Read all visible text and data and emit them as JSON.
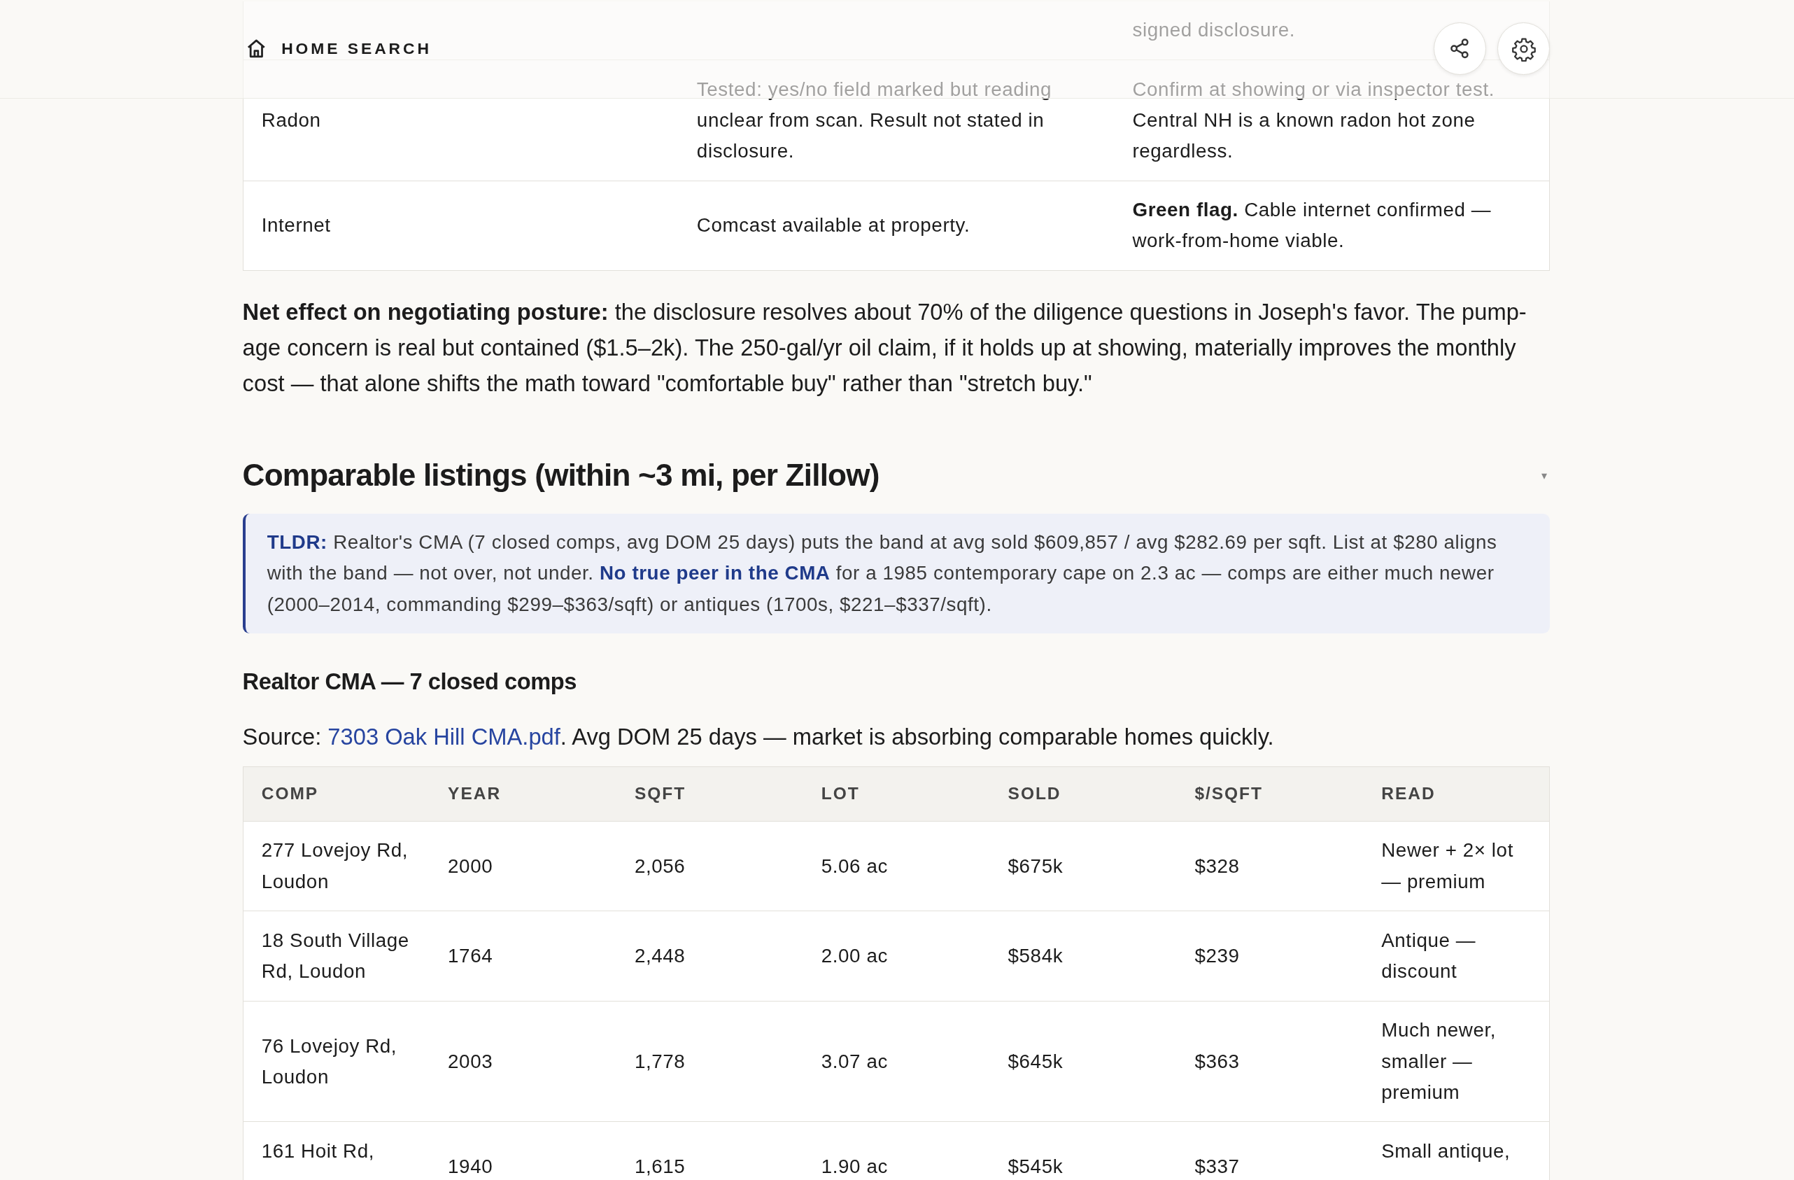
{
  "header": {
    "title": "HOME SEARCH"
  },
  "disclosure_table": {
    "rows": [
      {
        "column_3": "signed disclosure."
      },
      {
        "column_1": "Radon",
        "column_2": "Tested: yes/no field marked but reading unclear from scan. Result not stated in disclosure.",
        "column_3": "Confirm at showing or via inspector test. Central NH is a known radon hot zone regardless."
      },
      {
        "column_1": "Internet",
        "column_2": "Comcast available at property.",
        "column_3": "**Green flag.** Cable internet confirmed — work-from-home viable."
      }
    ]
  },
  "summary": "**Net effect on negotiating posture:** the disclosure resolves about 70% of the diligence questions in Joseph's favor. The pump-age concern is real but contained ($1.5–2k). The 250-gal/yr oil claim, if it holds up at showing, materially improves the monthly cost — that alone shifts the math toward \"comfortable buy\" rather than \"stretch buy.\"",
  "section": {
    "title": "Comparable listings (within ~3 mi, per Zillow)",
    "toggle": "▾",
    "tldr": "**TLDR:** Realtor's CMA (7 closed comps, avg DOM 25 days) puts the band at avg sold $609,857 / avg $282.69 per sqft. List at $280 aligns with the band — not over, not under. **No true peer in the CMA** for a 1985 contemporary cape on 2.3 ac — comps are either much newer (2000–2014, commanding $299–$363/sqft) or antiques (1700s, $221–$337/sqft).",
    "subtitle": "Realtor CMA — 7 closed comps",
    "source": {
      "prefix": "Source:",
      "link": "7303 Oak Hill CMA.pdf",
      "suffix": ". Avg DOM 25 days — market is absorbing comparable homes quickly."
    },
    "comps_table": {
      "columns": [
        "COMP",
        "YEAR",
        "SQFT",
        "LOT",
        "SOLD",
        "$/SQFT",
        "READ"
      ],
      "rows": [
        [
          "277 Lovejoy Rd, Loudon",
          "2000",
          "2,056",
          "5.06 ac",
          "$675k",
          "$328",
          "Newer + 2× lot — premium"
        ],
        [
          "18 South Village Rd, Loudon",
          "1764",
          "2,448",
          "2.00 ac",
          "$584k",
          "$239",
          "Antique — discount"
        ],
        [
          "76 Lovejoy Rd, Loudon",
          "2003",
          "1,778",
          "3.07 ac",
          "$645k",
          "$363",
          "Much newer, smaller — premium"
        ],
        [
          "161 Hoit Rd,",
          "1940",
          "1,615",
          "1.90 ac",
          "$545k",
          "$337",
          "Small antique,"
        ]
      ]
    }
  }
}
